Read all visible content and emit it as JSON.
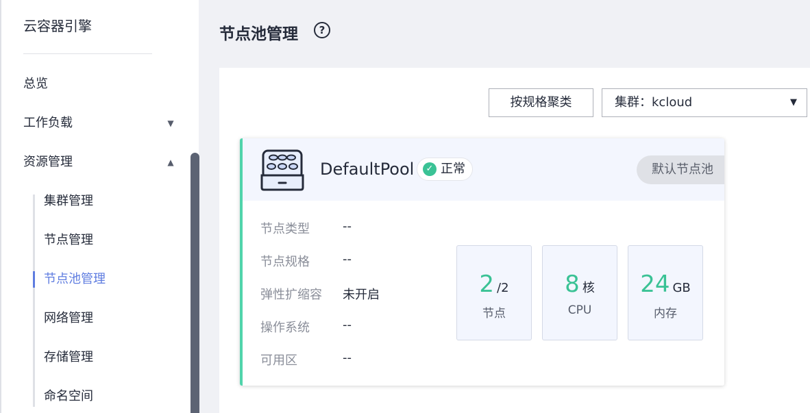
{
  "app": {
    "title": "云容器引擎"
  },
  "sidebar": {
    "items": [
      {
        "label": "总览",
        "arrow": ""
      },
      {
        "label": "工作负载",
        "arrow": "▼"
      },
      {
        "label": "资源管理",
        "arrow": "▲"
      }
    ],
    "sub_items": [
      {
        "label": "集群管理"
      },
      {
        "label": "节点管理"
      },
      {
        "label": "节点池管理"
      },
      {
        "label": "网络管理"
      },
      {
        "label": "存储管理"
      },
      {
        "label": "命名空间"
      }
    ],
    "active_sub_item": "节点池管理"
  },
  "header": {
    "title": "节点池管理",
    "help": "?"
  },
  "toolbar": {
    "group_button": "按规格聚类",
    "cluster_select": "集群：kcloud",
    "caret": "▼"
  },
  "pool": {
    "name": "DefaultPool",
    "status": "正常",
    "status_icon": "✓",
    "tag": "默认节点池",
    "info": [
      {
        "label": "节点类型",
        "value": "--"
      },
      {
        "label": "节点规格",
        "value": "--"
      },
      {
        "label": "弹性扩缩容",
        "value": "未开启"
      },
      {
        "label": "操作系统",
        "value": "--"
      },
      {
        "label": "可用区",
        "value": "--"
      }
    ],
    "stats": [
      {
        "num": "2",
        "unit": "/2",
        "label": "节点"
      },
      {
        "num": "8",
        "unit": "核",
        "label": "CPU"
      },
      {
        "num": "24",
        "unit": "GB",
        "label": "内存"
      }
    ]
  },
  "colors": {
    "accent": "#5e7ce0",
    "success": "#3ac295",
    "card_border": "#50d4ab"
  }
}
